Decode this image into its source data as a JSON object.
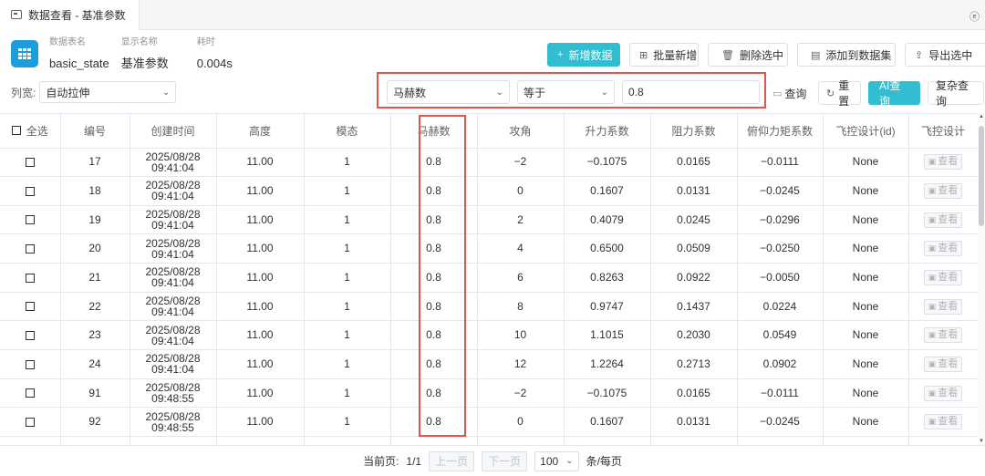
{
  "tab": {
    "title": "数据查看 - 基准参数",
    "right_glyph": "ⓔ"
  },
  "info": {
    "table_name_label": "数据表名",
    "table_name": "basic_state",
    "display_name_label": "显示名称",
    "display_name": "基准参数",
    "elapsed_label": "耗时",
    "elapsed": "0.004s"
  },
  "actions": {
    "add_data": "新增数据",
    "batch_add": "批量新增",
    "delete_selected": "删除选中",
    "add_to_dataset": "添加到数据集",
    "export_selected": "导出选中"
  },
  "column_width": {
    "label": "列宽:",
    "value": "自动拉伸"
  },
  "filter": {
    "field": "马赫数",
    "operator": "等于",
    "value": "0.8"
  },
  "controls": {
    "query": "查询",
    "reset": "重置",
    "ai_query": "AI查询",
    "complex_query": "复杂查询"
  },
  "table": {
    "select_all": "全选",
    "headers": [
      "编号",
      "创建时间",
      "高度",
      "模态",
      "马赫数",
      "攻角",
      "升力系数",
      "阻力系数",
      "俯仰力矩系数",
      "飞控设计(id)",
      "飞控设计"
    ],
    "view_label": "查看",
    "rows": [
      {
        "id": "17",
        "date": "2025/08/28",
        "time": "09:41:04",
        "height": "11.00",
        "mode": "1",
        "mach": "0.8",
        "aoa": "−2",
        "cl": "−0.1075",
        "cd": "0.0165",
        "cm": "−0.0111",
        "fc_id": "None"
      },
      {
        "id": "18",
        "date": "2025/08/28",
        "time": "09:41:04",
        "height": "11.00",
        "mode": "1",
        "mach": "0.8",
        "aoa": "0",
        "cl": "0.1607",
        "cd": "0.0131",
        "cm": "−0.0245",
        "fc_id": "None"
      },
      {
        "id": "19",
        "date": "2025/08/28",
        "time": "09:41:04",
        "height": "11.00",
        "mode": "1",
        "mach": "0.8",
        "aoa": "2",
        "cl": "0.4079",
        "cd": "0.0245",
        "cm": "−0.0296",
        "fc_id": "None"
      },
      {
        "id": "20",
        "date": "2025/08/28",
        "time": "09:41:04",
        "height": "11.00",
        "mode": "1",
        "mach": "0.8",
        "aoa": "4",
        "cl": "0.6500",
        "cd": "0.0509",
        "cm": "−0.0250",
        "fc_id": "None"
      },
      {
        "id": "21",
        "date": "2025/08/28",
        "time": "09:41:04",
        "height": "11.00",
        "mode": "1",
        "mach": "0.8",
        "aoa": "6",
        "cl": "0.8263",
        "cd": "0.0922",
        "cm": "−0.0050",
        "fc_id": "None"
      },
      {
        "id": "22",
        "date": "2025/08/28",
        "time": "09:41:04",
        "height": "11.00",
        "mode": "1",
        "mach": "0.8",
        "aoa": "8",
        "cl": "0.9747",
        "cd": "0.1437",
        "cm": "0.0224",
        "fc_id": "None"
      },
      {
        "id": "23",
        "date": "2025/08/28",
        "time": "09:41:04",
        "height": "11.00",
        "mode": "1",
        "mach": "0.8",
        "aoa": "10",
        "cl": "1.1015",
        "cd": "0.2030",
        "cm": "0.0549",
        "fc_id": "None"
      },
      {
        "id": "24",
        "date": "2025/08/28",
        "time": "09:41:04",
        "height": "11.00",
        "mode": "1",
        "mach": "0.8",
        "aoa": "12",
        "cl": "1.2264",
        "cd": "0.2713",
        "cm": "0.0902",
        "fc_id": "None"
      },
      {
        "id": "91",
        "date": "2025/08/28",
        "time": "09:48:55",
        "height": "11.00",
        "mode": "1",
        "mach": "0.8",
        "aoa": "−2",
        "cl": "−0.1075",
        "cd": "0.0165",
        "cm": "−0.0111",
        "fc_id": "None"
      },
      {
        "id": "92",
        "date": "2025/08/28",
        "time": "09:48:55",
        "height": "11.00",
        "mode": "1",
        "mach": "0.8",
        "aoa": "0",
        "cl": "0.1607",
        "cd": "0.0131",
        "cm": "−0.0245",
        "fc_id": "None"
      },
      {
        "id": "",
        "date": "2025/08/28",
        "time": "",
        "height": "",
        "mode": "",
        "mach": "",
        "aoa": "",
        "cl": "",
        "cd": "",
        "cm": "",
        "fc_id": ""
      }
    ]
  },
  "pager": {
    "current_label": "当前页:",
    "current": "1/1",
    "prev": "上一页",
    "next": "下一页",
    "page_size": "100",
    "per_page": "条/每页"
  },
  "colors": {
    "accent": "#33bdd0",
    "highlight": "#e5534b",
    "badge": "#1b9edb"
  }
}
